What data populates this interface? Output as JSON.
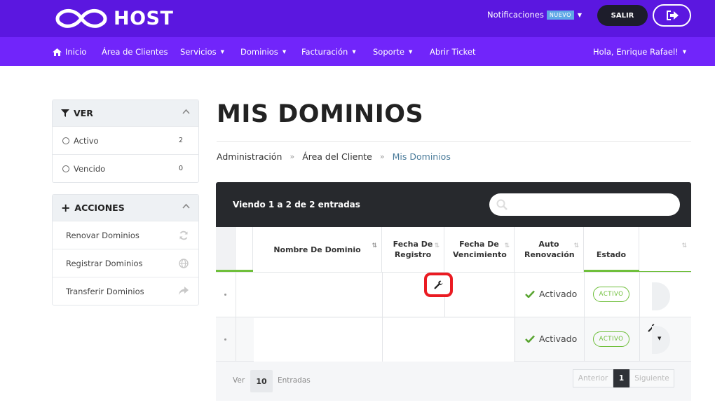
{
  "header": {
    "logo_text": "HOST",
    "notifications_label": "Notificaciones",
    "notifications_badge": "NUEVO",
    "logout_label": "SALIR"
  },
  "nav": {
    "items": [
      {
        "label": "Inicio"
      },
      {
        "label": "Área de Clientes"
      },
      {
        "label": "Servicios"
      },
      {
        "label": "Dominios"
      },
      {
        "label": "Facturación"
      },
      {
        "label": "Soporte"
      },
      {
        "label": "Abrir Ticket"
      }
    ],
    "user_greeting": "Hola, Enrique Rafael!"
  },
  "sidebar": {
    "filter": {
      "title": "VER",
      "items": [
        {
          "label": "Activo",
          "count": "2"
        },
        {
          "label": "Vencido",
          "count": "0"
        }
      ]
    },
    "actions": {
      "title": "ACCIONES",
      "items": [
        {
          "label": "Renovar Dominios",
          "icon": "refresh-icon"
        },
        {
          "label": "Registrar Dominios",
          "icon": "globe-icon"
        },
        {
          "label": "Transferir Dominios",
          "icon": "share-arrow-icon"
        }
      ]
    }
  },
  "main": {
    "title": "MIS DOMINIOS",
    "breadcrumb": [
      "Administración",
      "Área del Cliente",
      "Mis Dominios"
    ],
    "breadcrumb_sep": "»"
  },
  "table": {
    "info": "Viendo 1 a 2 de 2 entradas",
    "search_placeholder": "",
    "columns": [
      {
        "label": "Nombre De Dominio"
      },
      {
        "label": "Fecha De Registro"
      },
      {
        "label": "Fecha De Vencimiento"
      },
      {
        "label": "Auto Renovación"
      },
      {
        "label": "Estado"
      }
    ],
    "rows": [
      {
        "auto_renew": "Activado",
        "status": "ACTIVO"
      },
      {
        "auto_renew": "Activado",
        "status": "ACTIVO"
      }
    ],
    "footer": {
      "show_label": "Ver",
      "page_size": "10",
      "entries_label": "Entradas",
      "prev_label": "Anterior",
      "current_page": "1",
      "next_label": "Siguiente"
    }
  },
  "colors": {
    "topbar": "#5b17e0",
    "navbar": "#7125fa",
    "accent_green": "#6fbf3b",
    "highlight_red": "#ea1b22"
  }
}
